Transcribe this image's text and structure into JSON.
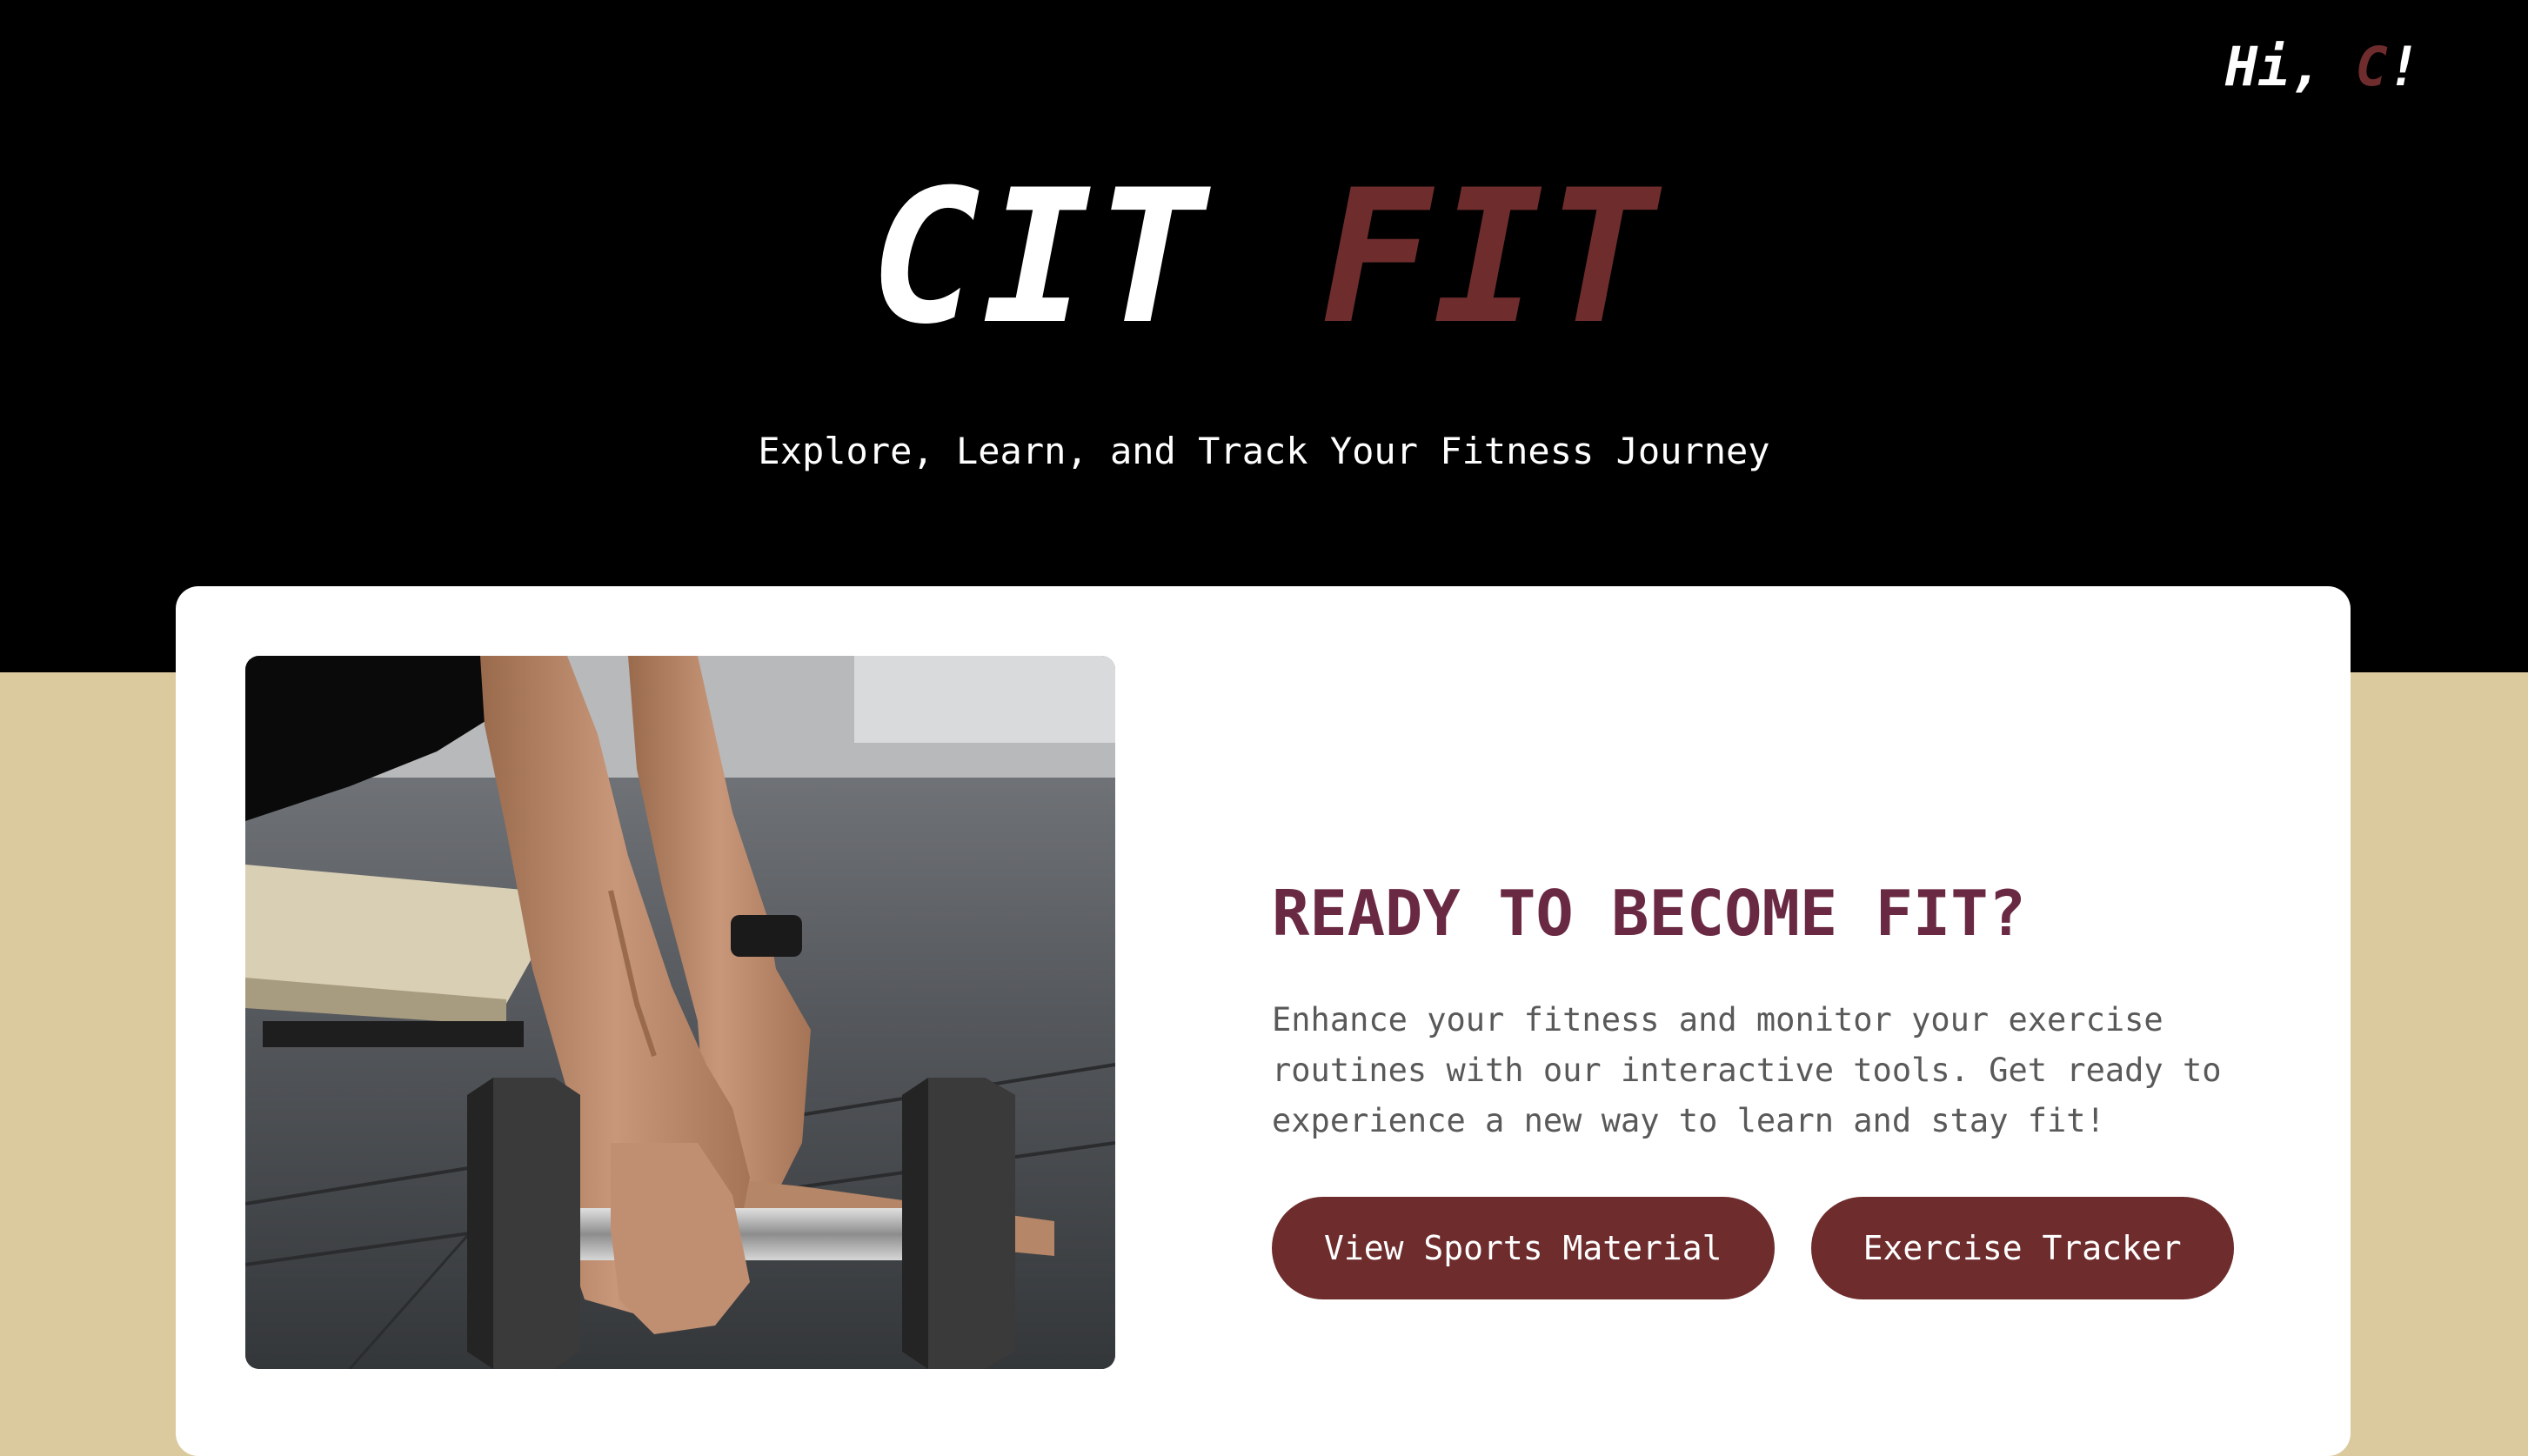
{
  "header": {
    "greeting_prefix": "Hi, ",
    "greeting_name": "C",
    "greeting_suffix": "!",
    "brand_primary": "CIT",
    "brand_accent": "FIT",
    "tagline": "Explore, Learn, and Track Your Fitness Journey"
  },
  "promo": {
    "image": "dumbbell-pushup-photo",
    "headline": "READY TO BECOME FIT?",
    "description": "Enhance your fitness and monitor your exercise routines with our interactive tools. Get ready to experience a new way to learn and stay fit!",
    "buttons": {
      "sports_material": "View Sports Material",
      "exercise_tracker": "Exercise Tracker"
    }
  },
  "colors": {
    "hero_background": "#000000",
    "page_background": "#dcca9f",
    "accent": "#6e2c2d",
    "headline": "#6a2942",
    "body_text": "#595959"
  }
}
